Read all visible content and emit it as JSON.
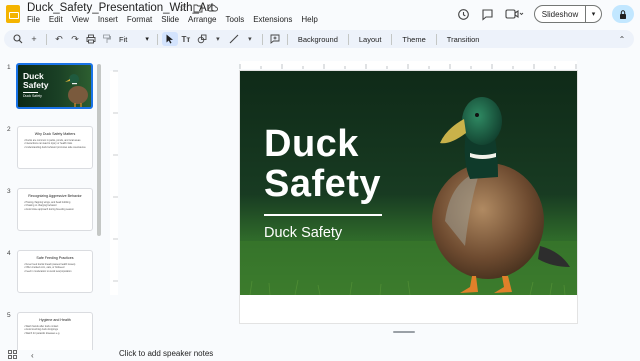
{
  "header": {
    "title": "Duck_Safety_Presentation_With_Art",
    "menu": [
      "File",
      "Edit",
      "View",
      "Insert",
      "Format",
      "Slide",
      "Arrange",
      "Tools",
      "Extensions",
      "Help"
    ],
    "slideshow_label": "Slideshow"
  },
  "toolbar": {
    "zoom_value": "Fit",
    "background_label": "Background",
    "layout_label": "Layout",
    "theme_label": "Theme",
    "transition_label": "Transition"
  },
  "filmstrip": {
    "slides": [
      {
        "number": "1",
        "title": "Duck Safety",
        "subtitle": "Duck Safety"
      },
      {
        "number": "2",
        "title": "Why Duck Safety Matters",
        "bullets": [
          "Ducks are common in parks, ponds, and rural areas",
          "Interactions can lead to injury or health risks",
          "Understanding duck behavior promotes safe coexistence"
        ]
      },
      {
        "number": "3",
        "title": "Recognizing Aggressive Behavior",
        "bullets": [
          "Hissing, flapping wings, and head bobbing",
          "Chasing or charging behavior",
          "Avoid close approach during breeding season"
        ]
      },
      {
        "number": "4",
        "title": "Safe Feeding Practices",
        "bullets": [
          "Never feed ducks bread (causes health issues)",
          "Offer cracked corn, oats, or birdseed",
          "Feed in moderation to avoid overpopulation"
        ]
      },
      {
        "number": "5",
        "title": "Hygiene and Health",
        "bullets": [
          "Wash hands after duck contact",
          "Avoid touching duck droppings",
          "Watch for parasitic diseases e.g."
        ]
      }
    ]
  },
  "slide": {
    "title_line1": "Duck",
    "title_line2": "Safety",
    "subtitle": "Duck Safety"
  },
  "notes": {
    "placeholder": "Click to add speaker notes"
  },
  "colors": {
    "accent": "#1a73e8",
    "slide_bg": "#1a4025",
    "toolbar_bg": "#edf2fa"
  }
}
